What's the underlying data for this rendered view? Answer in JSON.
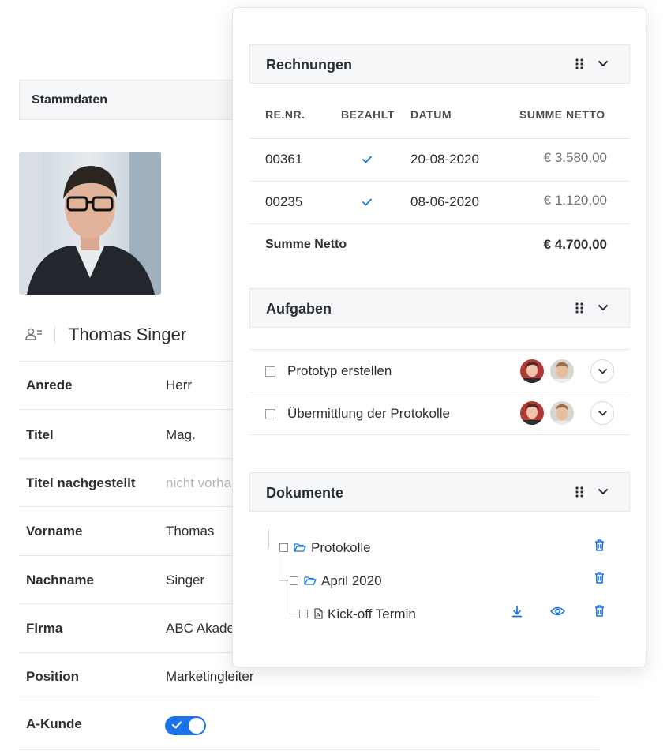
{
  "stammdaten": {
    "title": "Stammdaten"
  },
  "person": {
    "name": "Thomas Singer",
    "fields": [
      {
        "label": "Anrede",
        "value": "Herr",
        "muted": false
      },
      {
        "label": "Titel",
        "value": "Mag.",
        "muted": false
      },
      {
        "label": "Titel nachgestellt",
        "value": "nicht vorhanden",
        "muted": true
      },
      {
        "label": "Vorname",
        "value": "Thomas",
        "muted": false
      },
      {
        "label": "Nachname",
        "value": "Singer",
        "muted": false
      },
      {
        "label": "Firma",
        "value": "ABC Akademie",
        "muted": false
      },
      {
        "label": "Position",
        "value": "Marketingleiter",
        "muted": false
      }
    ],
    "a_kunde": {
      "label": "A-Kunde",
      "enabled": true
    }
  },
  "rechnungen": {
    "title": "Rechnungen",
    "columns": [
      "RE.NR.",
      "BEZAHLT",
      "DATUM",
      "SUMME NETTO"
    ],
    "rows": [
      {
        "nr": "00361",
        "paid": true,
        "date": "20-08-2020",
        "amount": "€ 3.580,00"
      },
      {
        "nr": "00235",
        "paid": true,
        "date": "08-06-2020",
        "amount": "€ 1.120,00"
      }
    ],
    "sum_label": "Summe Netto",
    "sum_value": "€ 4.700,00"
  },
  "aufgaben": {
    "title": "Aufgaben",
    "tasks": [
      {
        "label": "Prototyp erstellen"
      },
      {
        "label": "Übermittlung der Protokolle"
      }
    ]
  },
  "dokumente": {
    "title": "Dokumente",
    "tree": [
      {
        "label": "Protokolle",
        "type": "folder",
        "level": 0
      },
      {
        "label": "April 2020",
        "type": "folder",
        "level": 1
      },
      {
        "label": "Kick-off Termin",
        "type": "pdf",
        "level": 2
      }
    ]
  },
  "colors": {
    "accent": "#1a73e8",
    "text": "#2b2f33",
    "muted": "#b3b7bb",
    "header_bg": "#f6f7f8"
  },
  "icons": [
    "contact-icon",
    "drag-handle-icon",
    "chevron-down-icon",
    "checkmark-icon",
    "folder-open-icon",
    "pdf-file-icon",
    "download-icon",
    "eye-icon",
    "trash-icon"
  ]
}
